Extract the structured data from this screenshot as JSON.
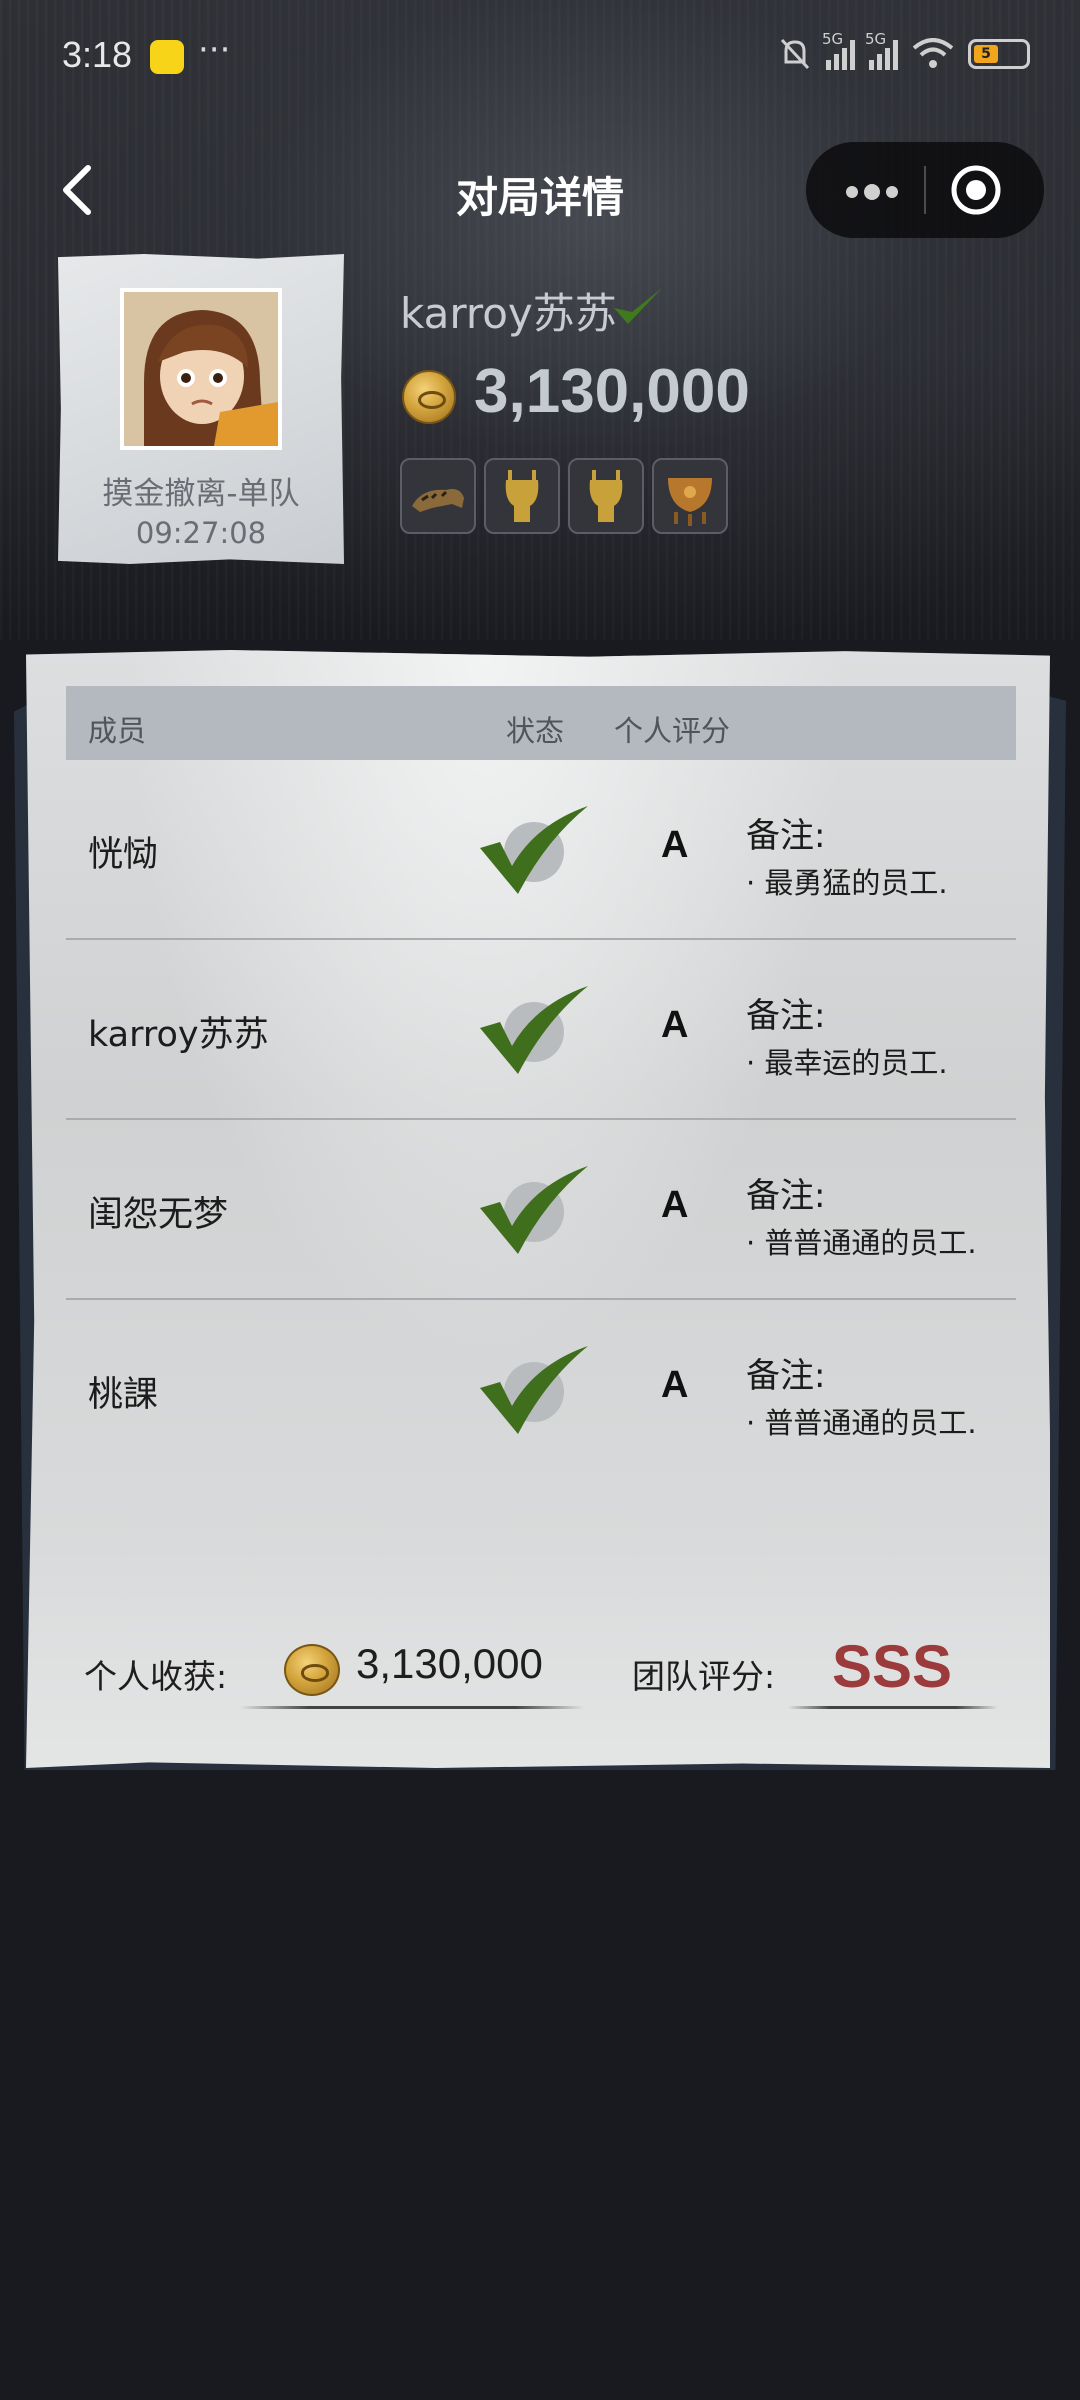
{
  "status_bar": {
    "time": "3:18",
    "dots": "···",
    "network_1": "5G",
    "network_2": "5G",
    "battery": "5"
  },
  "header": {
    "title": "对局详情"
  },
  "profile": {
    "mode": "摸金撤离-单队",
    "time": "09:27:08",
    "player_name": "karroy苏苏",
    "total_value": "3,130,000",
    "items": [
      "tiger-figurine-icon",
      "golden-vessel-icon",
      "golden-vessel-icon",
      "bronze-cauldron-icon"
    ]
  },
  "table": {
    "headers": {
      "member": "成员",
      "status": "状态",
      "score": "个人评分"
    },
    "rows": [
      {
        "name": "恍恸",
        "grade": "A",
        "note_title": "备注:",
        "note": "· 最勇猛的员工."
      },
      {
        "name": "karroy苏苏",
        "grade": "A",
        "note_title": "备注:",
        "note": "· 最幸运的员工."
      },
      {
        "name": "闺怨无梦",
        "grade": "A",
        "note_title": "备注:",
        "note": "· 普普通通的员工."
      },
      {
        "name": "桃課",
        "grade": "A",
        "note_title": "备注:",
        "note": "· 普普通通的员工."
      }
    ]
  },
  "footer": {
    "income_label": "个人收获:",
    "income_value": "3,130,000",
    "team_label": "团队评分:",
    "team_grade": "SSS"
  },
  "colors": {
    "background": "#191a1f",
    "check_green": "#3f6e1c",
    "team_grade": "#9b3b3b"
  }
}
